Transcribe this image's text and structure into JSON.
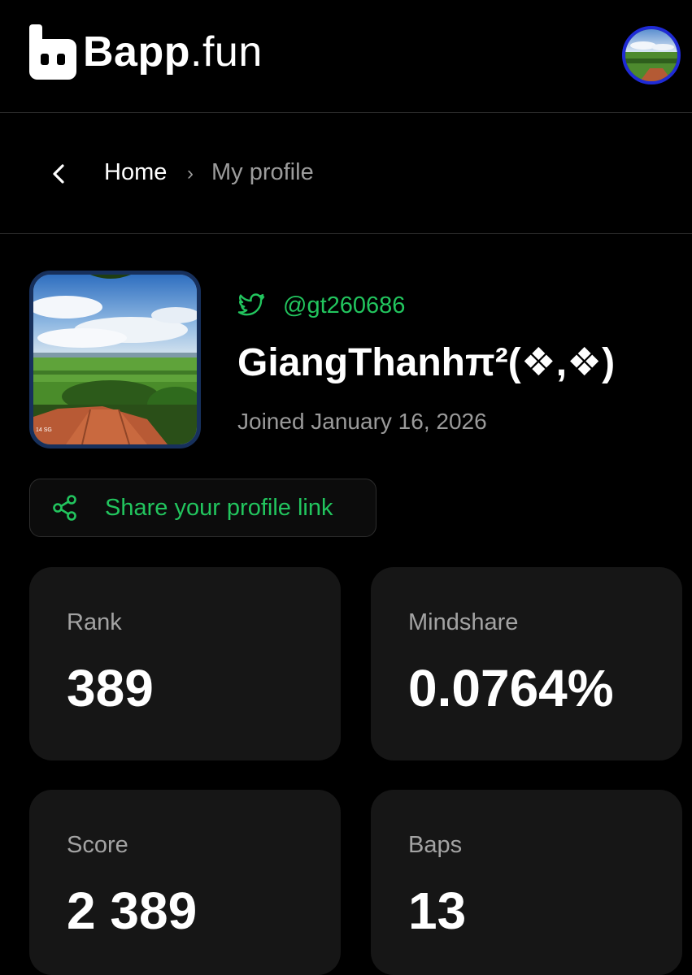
{
  "header": {
    "brand_bold": "Bapp",
    "brand_light": ".fun",
    "logo_icon": "bapp-logo-icon",
    "avatar_icon": "user-avatar"
  },
  "breadcrumb": {
    "back_icon": "chevron-left-icon",
    "home": "Home",
    "separator": "›",
    "current": "My profile"
  },
  "profile": {
    "twitter_icon": "twitter-icon",
    "handle": "@gt260686",
    "display_name": "GiangThanhπ²(❖,❖)",
    "joined": "Joined January 16, 2026",
    "photo_watermark": "14 SG"
  },
  "share": {
    "icon": "share-icon",
    "label": "Share your profile link"
  },
  "stats": [
    {
      "label": "Rank",
      "value": "389"
    },
    {
      "label": "Mindshare",
      "value": "0.0764%"
    },
    {
      "label": "Score",
      "value": "2 389"
    },
    {
      "label": "Baps",
      "value": "13"
    }
  ],
  "colors": {
    "background": "#000000",
    "card": "#161616",
    "accent_green": "#22c55e",
    "muted_text": "#9a9a9a",
    "avatar_ring": "#1f2bd6"
  }
}
